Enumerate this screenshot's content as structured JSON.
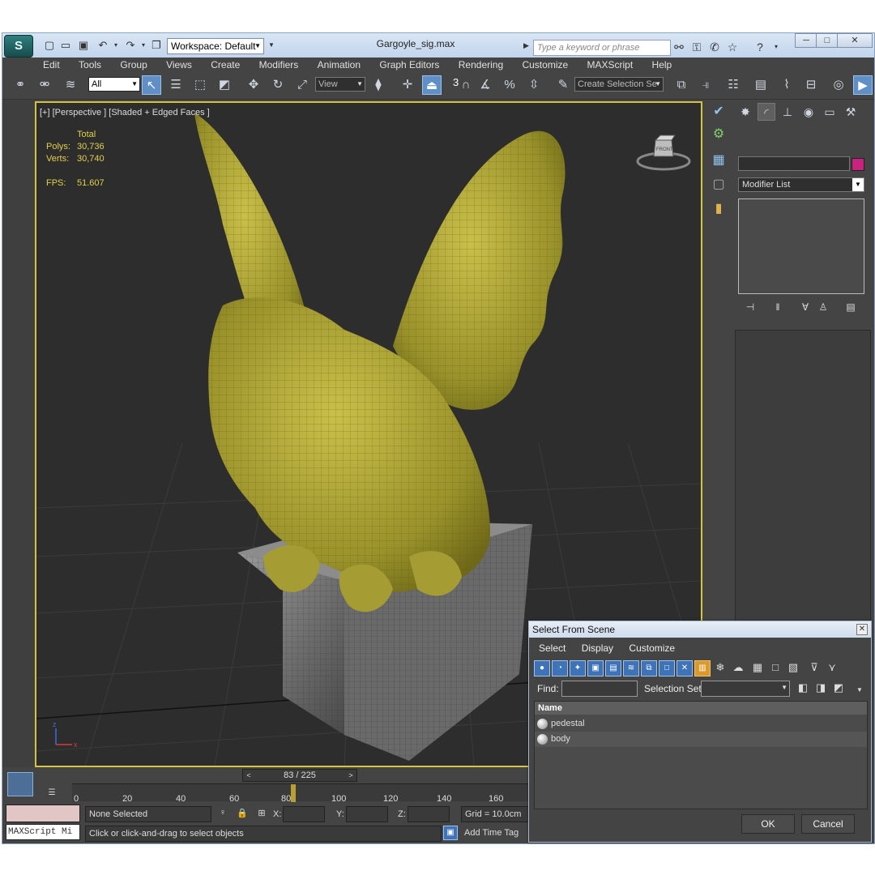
{
  "window": {
    "title": "Gargoyle_sig.max",
    "workspace": "Workspace: Default",
    "search_placeholder": "Type a keyword or phrase",
    "logo_glyph": "S"
  },
  "menu": [
    "Edit",
    "Tools",
    "Group",
    "Views",
    "Create",
    "Modifiers",
    "Animation",
    "Graph Editors",
    "Rendering",
    "Customize",
    "MAXScript",
    "Help"
  ],
  "toolbar": {
    "selection_filter": "All",
    "reference_coord": "View",
    "snap_angle": "3",
    "named_selection": "Create Selection Se"
  },
  "viewport": {
    "label": "[+] [Perspective ] [Shaded + Edged Faces ]",
    "stats_header": "Total",
    "polys_label": "Polys:",
    "polys_value": "30,736",
    "verts_label": "Verts:",
    "verts_value": "30,740",
    "fps_label": "FPS:",
    "fps_value": "51.607",
    "viewcube_label": "FRONT",
    "colors": {
      "border": "#d6c33e",
      "model": "#b5ad3a",
      "stats": "#e4d04a"
    }
  },
  "command_panel": {
    "modifier_list": "Modifier List",
    "color_swatch": "#c8247f"
  },
  "timeline": {
    "frame_display": "83 / 225",
    "ticks": [
      "0",
      "20",
      "40",
      "60",
      "80",
      "100",
      "120",
      "140",
      "160"
    ]
  },
  "status": {
    "selection": "None Selected",
    "x_label": "X:",
    "y_label": "Y:",
    "z_label": "Z:",
    "grid": "Grid = 10.0cm",
    "prompt": "Click or click-and-drag to select objects",
    "add_time_tag": "Add Time Tag",
    "maxscript": "MAXScript Mi"
  },
  "dialog": {
    "title": "Select From Scene",
    "menu": [
      "Select",
      "Display",
      "Customize"
    ],
    "find_label": "Find:",
    "selection_set_label": "Selection Set:",
    "column_name": "Name",
    "objects": [
      "pedestal",
      "body"
    ],
    "ok": "OK",
    "cancel": "Cancel"
  }
}
